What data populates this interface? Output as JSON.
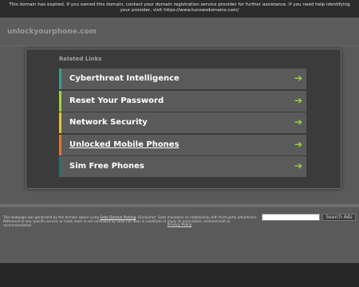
{
  "notice": {
    "text": "This domain has expired. If you owned this domain, contact your domain registration service provider for further assistance. If you need help identifying your provider, visit https://www.tucowsdomains.com/"
  },
  "header": {
    "domain": "unlockyourphone.com"
  },
  "related": {
    "heading": "Related Links",
    "items": [
      {
        "label": "Cyberthreat Intelligence",
        "accent": "#3f9b93",
        "underlined": false
      },
      {
        "label": "Reset Your Password",
        "accent": "#9fd43f",
        "underlined": false
      },
      {
        "label": "Network Security",
        "accent": "#e6c33a",
        "underlined": false
      },
      {
        "label": "Unlocked Mobile Phones",
        "accent": "#e07a2e",
        "underlined": true
      },
      {
        "label": "Sim Free Phones",
        "accent": "#2a6f73",
        "underlined": false
      }
    ],
    "arrow_icon": "arrow-right-icon",
    "arrow_color": "#9fd43f"
  },
  "footer": {
    "disclaimer_pre": "This webpage was generated by the domain owner using ",
    "disclaimer_link": "Sedo Domain Parking",
    "disclaimer_post": ". Disclaimer: Sedo maintains no relationship with third party advertisers. Reference to any specific service or trade mark is not controlled by Sedo nor does it constitute or imply its association, endorsement or recommendation.",
    "search_placeholder": "",
    "search_button": "Search Ads",
    "privacy": "Privacy Policy"
  }
}
